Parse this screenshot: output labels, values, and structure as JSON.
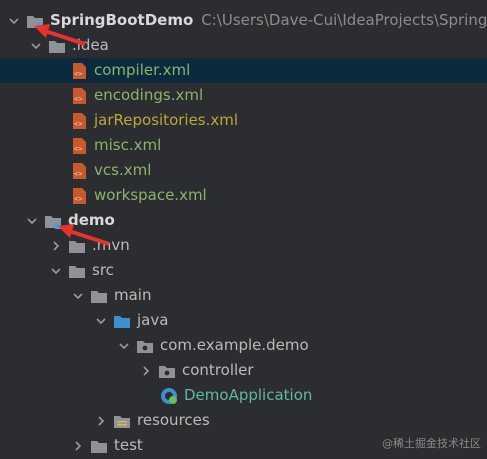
{
  "tree": {
    "root": {
      "label": "SpringBootDemo",
      "path": "C:\\Users\\Dave-Cui\\IdeaProjects\\SpringB"
    },
    "idea": {
      "label": ".idea",
      "files": [
        {
          "label": "compiler.xml"
        },
        {
          "label": "encodings.xml"
        },
        {
          "label": "jarRepositories.xml"
        },
        {
          "label": "misc.xml"
        },
        {
          "label": "vcs.xml"
        },
        {
          "label": "workspace.xml"
        }
      ]
    },
    "demo": {
      "label": "demo",
      "mvn": ".mvn",
      "src": "src",
      "main": "main",
      "java": "java",
      "package": "com.example.demo",
      "controller": "controller",
      "app": "DemoApplication",
      "resources": "resources",
      "test": "test"
    }
  },
  "watermark": "@稀土掘金技术社区",
  "colors": {
    "background": "#2b2d30",
    "selected_row": "#0d293e",
    "file_green": "#8db36b",
    "file_olive": "#b9a839",
    "annotation_red": "#e8322b"
  },
  "icons": {
    "folder": "folder-icon",
    "module": "module-folder-icon",
    "xml": "xml-file-icon",
    "package": "package-icon",
    "source": "source-folder-icon",
    "resources": "resources-folder-icon",
    "spring": "spring-class-icon"
  }
}
